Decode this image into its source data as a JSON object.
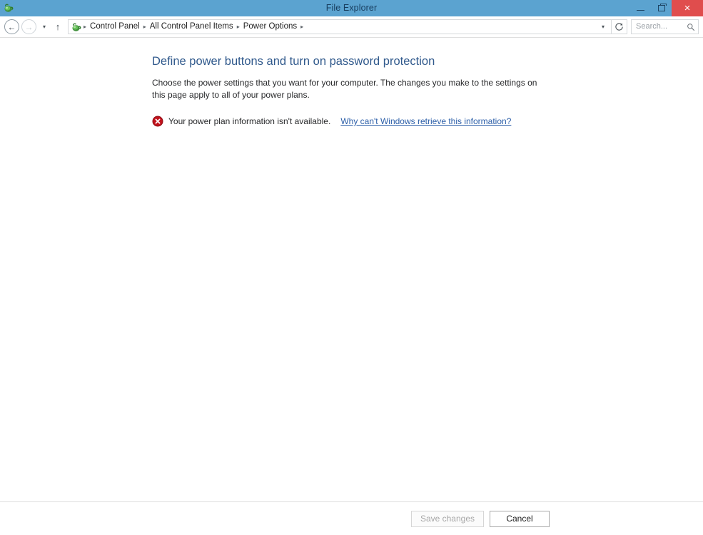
{
  "window": {
    "title": "File Explorer",
    "app_icon": "control-panel-icon",
    "controls": {
      "minimize_label": "—",
      "restore_label": "❐",
      "close_label": "×"
    },
    "accent_titlebar_color": "#5BA3D0",
    "close_button_color": "#E04D4D"
  },
  "navbar": {
    "back_label": "←",
    "forward_label": "→",
    "recent_dropdown_label": "▾",
    "up_label": "↑",
    "address_dropdown_label": "▾",
    "refresh_label": "↻",
    "breadcrumbs": [
      {
        "label": "Control Panel"
      },
      {
        "label": "All Control Panel Items"
      },
      {
        "label": "Power Options"
      }
    ],
    "separator": "▸"
  },
  "search": {
    "placeholder": "Search...",
    "icon": "search-icon"
  },
  "main": {
    "heading": "Define power buttons and turn on password protection",
    "description": "Choose the power settings that you want for your computer. The changes you make to the settings on this page apply to all of your power plans.",
    "heading_color": "#30598C",
    "status": {
      "icon": "error-icon",
      "icon_color": "#C1121C",
      "message": "Your power plan information isn't available.",
      "link_text": "Why can't Windows retrieve this information?",
      "link_color": "#2B5EA8"
    }
  },
  "footer": {
    "save_label": "Save changes",
    "save_enabled": false,
    "cancel_label": "Cancel",
    "cancel_enabled": true
  }
}
